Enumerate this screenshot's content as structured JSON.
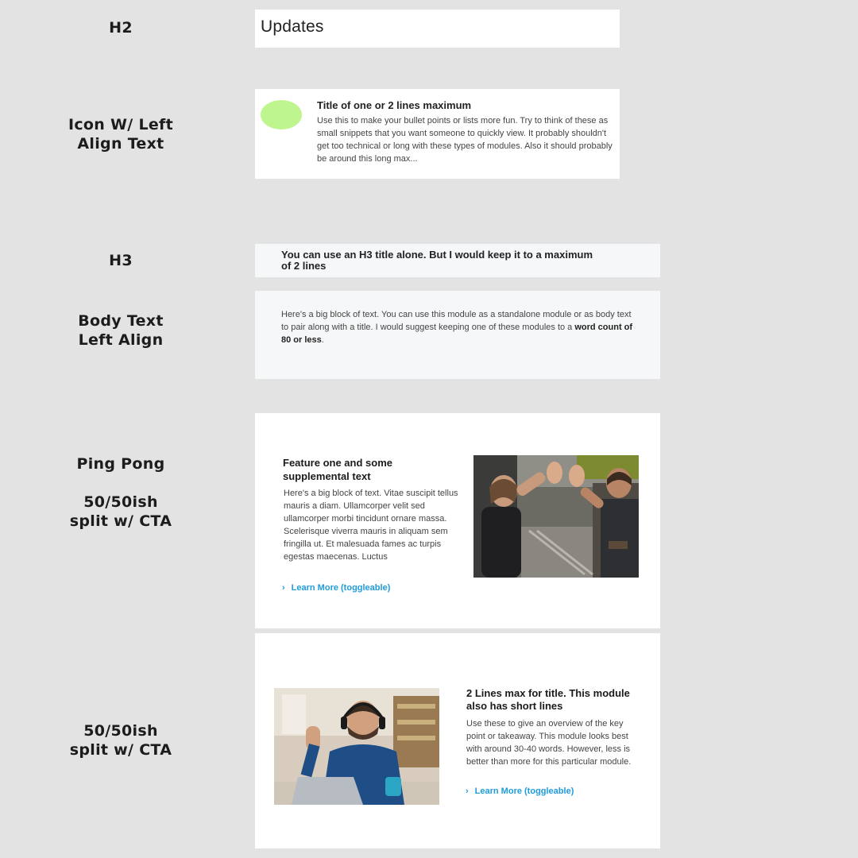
{
  "labels": {
    "h2": "H2",
    "icon_line1": "Icon W/ Left",
    "icon_line2": "Align Text",
    "h3": "H3",
    "body_line1": "Body Text",
    "body_line2": "Left Align",
    "pingpong_line1": "Ping Pong",
    "pingpong_line2": "50/50ish",
    "pingpong_line3": "split w/ CTA",
    "split_line1": "50/50ish",
    "split_line2": "split w/ CTA"
  },
  "h2_module": {
    "text": "Updates"
  },
  "icon_module": {
    "icon_color": "#bff58f",
    "title": "Title of one or 2 lines maximum",
    "body": "Use this to make your bullet points or lists more fun. Try to think of these as small snippets that you want someone to quickly view. It probably shouldn't get too technical or long with these types of modules. Also it should probably be around this long max..."
  },
  "h3_module": {
    "text": "You can use an H3 title alone. But I would keep it to a maximum of 2 lines"
  },
  "body_module": {
    "body_start": "Here's a big block of text. You can use this module as a standalone module or as body text to pair along with a title. I would suggest keeping one of these modules to a ",
    "body_bold": "word count of 80 or less",
    "body_end": "."
  },
  "pingpong_module": {
    "title": "Feature one and some supplemental text",
    "body": "Here's a big block of text. Vitae suscipit tellus mauris a diam. Ullamcorper velit sed ullamcorper morbi tincidunt ornare massa. Scelerisque viverra mauris in aliquam sem fringilla ut. Et malesuada fames ac turpis egestas maecenas. Luctus",
    "cta": "Learn More (toggleable)",
    "cta_icon": "chevron-right-icon"
  },
  "split_module": {
    "title": "2 Lines max for title. This module also has short lines",
    "body": "Use these to give an overview of the key point or takeaway. This module looks best with around 30-40 words. However, less is better than more for this particular module.",
    "cta": "Learn More (toggleable)",
    "cta_icon": "chevron-right-icon"
  },
  "colors": {
    "accent": "#1f9cda",
    "background": "#e3e3e3",
    "card": "#ffffff",
    "card_alt": "#f6f7f9"
  }
}
